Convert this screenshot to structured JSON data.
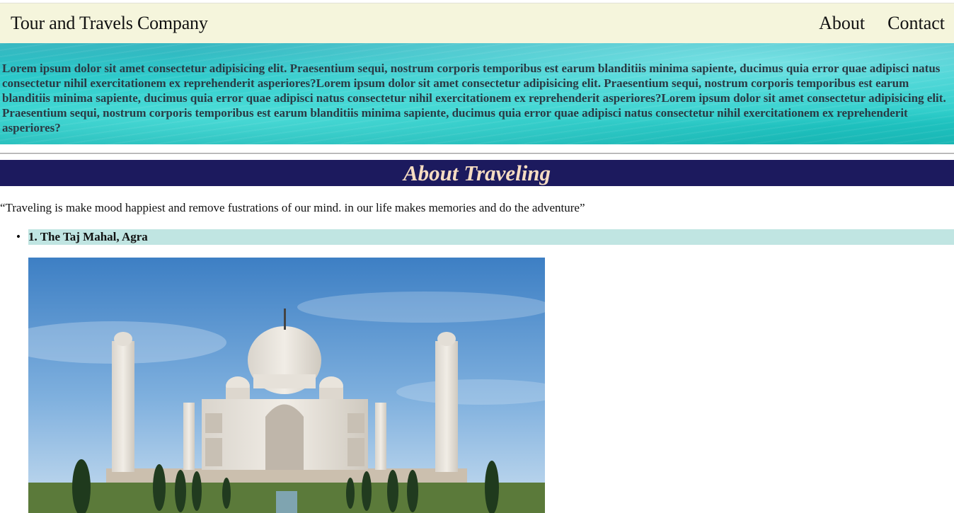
{
  "header": {
    "brand": "Tour and Travels Company",
    "nav": [
      "About",
      "Contact"
    ]
  },
  "hero": {
    "text": "Lorem ipsum dolor sit amet consectetur adipisicing elit. Praesentium sequi, nostrum corporis temporibus est earum blanditiis minima sapiente, ducimus quia error quae adipisci natus consectetur nihil exercitationem ex reprehenderit asperiores?Lorem ipsum dolor sit amet consectetur adipisicing elit. Praesentium sequi, nostrum corporis temporibus est earum blanditiis minima sapiente, ducimus quia error quae adipisci natus consectetur nihil exercitationem ex reprehenderit asperiores?Lorem ipsum dolor sit amet consectetur adipisicing elit. Praesentium sequi, nostrum corporis temporibus est earum blanditiis minima sapiente, ducimus quia error quae adipisci natus consectetur nihil exercitationem ex reprehenderit asperiores?"
  },
  "about": {
    "title": "About Traveling",
    "quote": "“Traveling is make mood happiest and remove fustrations of our mind. in our life makes memories and do the adventure”"
  },
  "places": [
    {
      "title": "1. The Taj Mahal, Agra",
      "image": "taj-mahal-photo"
    }
  ],
  "colors": {
    "header_bg": "#f5f5dc",
    "section_title_bg": "#1c1a5e",
    "section_title_text": "#f6dcc2",
    "place_bar_bg": "#c0e5e2"
  }
}
